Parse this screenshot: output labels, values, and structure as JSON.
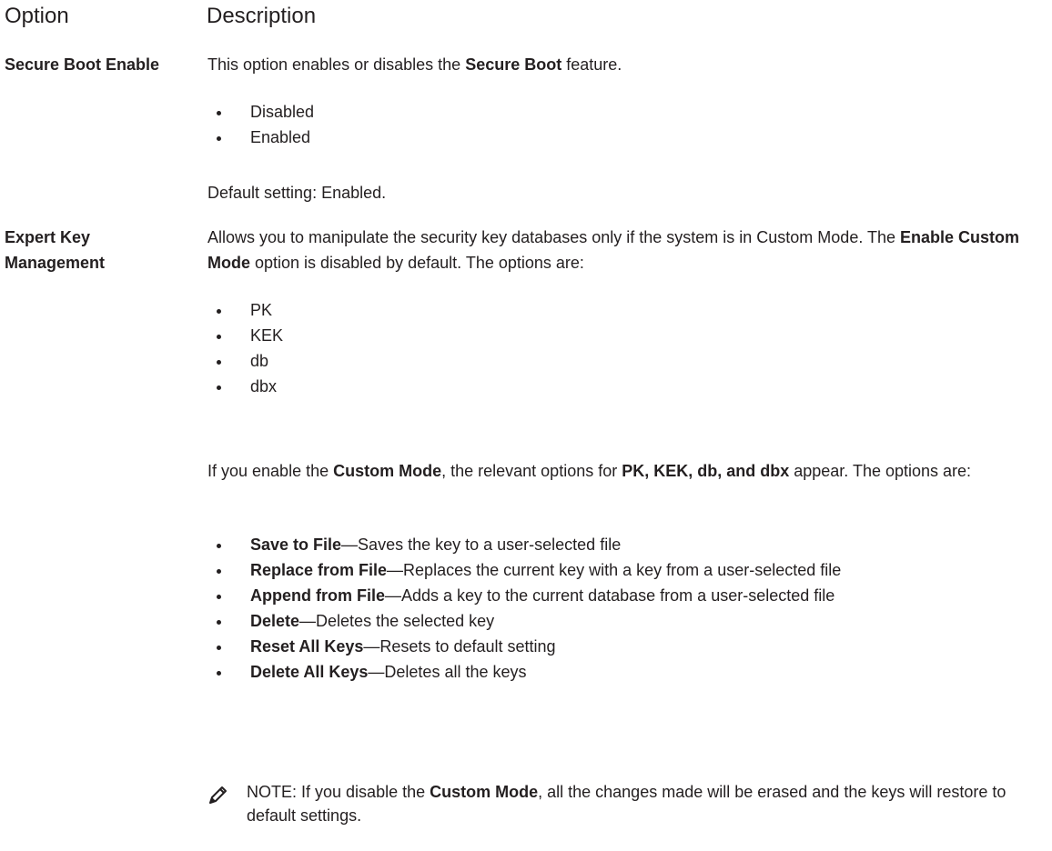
{
  "header": {
    "option": "Option",
    "description": "Description"
  },
  "secure_boot": {
    "name": "Secure Boot Enable",
    "intro_pre": "This option enables or disables the ",
    "intro_bold": "Secure Boot",
    "intro_post": " feature.",
    "options": [
      "Disabled",
      "Enabled"
    ],
    "default": "Default setting: Enabled."
  },
  "expert_key": {
    "name": "Expert Key Management",
    "intro1_pre": "Allows you to manipulate the security key databases only if the system is in Custom Mode. The ",
    "intro1_bold": "Enable Custom Mode",
    "intro1_post": " option is disabled by default. The options are:",
    "keys": [
      "PK",
      "KEK",
      "db",
      "dbx"
    ],
    "intro2_pre": "If you enable the ",
    "intro2_bold1": "Custom Mode",
    "intro2_mid": ", the relevant options for ",
    "intro2_bold2": "PK, KEK, db, and dbx",
    "intro2_post": " appear. The options are:",
    "actions": [
      {
        "name": "Save to File",
        "desc": "—Saves the key to a user-selected file"
      },
      {
        "name": "Replace from File",
        "desc": "—Replaces the current key with a key from a user-selected file"
      },
      {
        "name": "Append from File",
        "desc": "—Adds a key to the current database from a user-selected file"
      },
      {
        "name": "Delete",
        "desc": "—Deletes the selected key"
      },
      {
        "name": "Reset All Keys",
        "desc": "—Resets to default setting"
      },
      {
        "name": "Delete All Keys",
        "desc": "—Deletes all the keys"
      }
    ],
    "note_label": "NOTE:",
    "note_pre": " If you disable the ",
    "note_bold": "Custom Mode",
    "note_post": ", all the changes made will be erased and the keys will restore to default settings."
  },
  "note_icon": "pencil-note-icon"
}
